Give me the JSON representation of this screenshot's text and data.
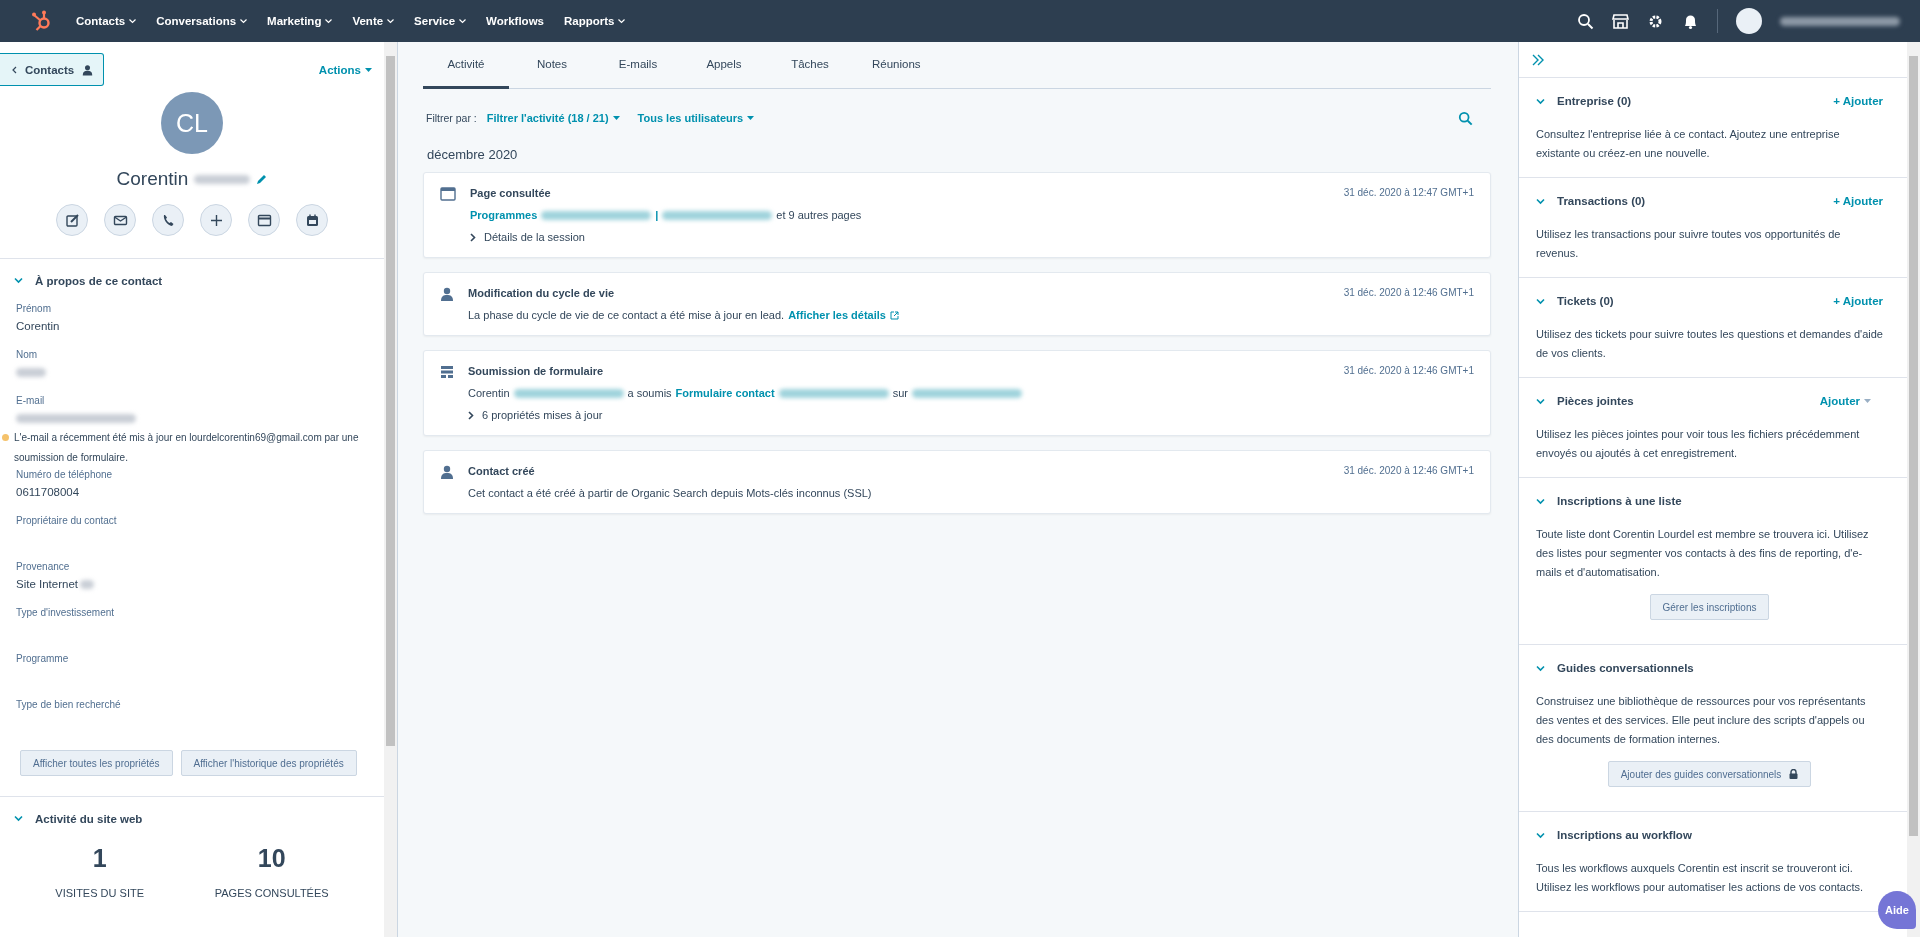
{
  "nav": {
    "items": [
      {
        "label": "Contacts",
        "dropdown": true
      },
      {
        "label": "Conversations",
        "dropdown": true
      },
      {
        "label": "Marketing",
        "dropdown": true
      },
      {
        "label": "Vente",
        "dropdown": true
      },
      {
        "label": "Service",
        "dropdown": true
      },
      {
        "label": "Workflows",
        "dropdown": false
      },
      {
        "label": "Rapports",
        "dropdown": true
      }
    ]
  },
  "contact": {
    "back": "Contacts",
    "actions": "Actions",
    "initials": "CL",
    "first_name": "Corentin"
  },
  "about": {
    "title": "À propos de ce contact",
    "expanded": true,
    "fields": [
      {
        "label": "Prénom",
        "value": "Corentin"
      },
      {
        "label": "Nom",
        "redacted": true
      },
      {
        "label": "E-mail",
        "redacted": true,
        "warning": "L'e-mail a récemment été mis à jour en lourdelcorentin69@gmail.com par une soumission de formulaire."
      },
      {
        "label": "Numéro de téléphone",
        "value": "0611708004"
      },
      {
        "label": "Propriétaire du contact"
      },
      {
        "label": "Provenance",
        "value": "Site Internet",
        "redacted": true
      },
      {
        "label": "Type d'investissement"
      },
      {
        "label": "Programme"
      },
      {
        "label": "Type de bien recherché"
      }
    ],
    "buttons": [
      "Afficher toutes les propriétés",
      "Afficher l'historique des propriétés"
    ]
  },
  "website_activity": {
    "title": "Activité du site web",
    "expanded": true,
    "stats": [
      {
        "value": "1",
        "label": "VISITES DU SITE"
      },
      {
        "value": "10",
        "label": "PAGES CONSULTÉES"
      }
    ]
  },
  "tabs": [
    {
      "label": "Activité",
      "selected": true
    },
    {
      "label": "Notes",
      "selected": false
    },
    {
      "label": "E-mails",
      "selected": false
    },
    {
      "label": "Appels",
      "selected": false
    },
    {
      "label": "Tâches",
      "selected": false
    },
    {
      "label": "Réunions",
      "selected": false
    }
  ],
  "filter": {
    "label": "Filtrer par :",
    "options": [
      "Filtrer l'activité (18 / 21)",
      "Tous les utilisateurs"
    ]
  },
  "month": "décembre 2020",
  "events": [
    {
      "kind": "page",
      "title": "Page consultée",
      "time": "31 déc. 2020 à 12:47 GMT+1",
      "parts": [
        {
          "kind": "link",
          "text": "Programmes"
        },
        {
          "kind": "redacted"
        },
        {
          "kind": "link",
          "text": "|"
        },
        {
          "kind": "redacted"
        },
        {
          "kind": "text",
          "text": "et 9 autres pages"
        }
      ],
      "detail": "Détails de la session"
    },
    {
      "kind": "lifecycle",
      "title": "Modification du cycle de vie",
      "time": "31 déc. 2020 à 12:46 GMT+1",
      "parts": [
        {
          "kind": "text",
          "text": "La phase du cycle de vie de ce contact a été mise à jour en lead."
        },
        {
          "kind": "external",
          "text": "Afficher les détails"
        }
      ]
    },
    {
      "kind": "form",
      "title": "Soumission de formulaire",
      "time": "31 déc. 2020 à 12:46 GMT+1",
      "parts": [
        {
          "kind": "text",
          "text": "Corentin"
        },
        {
          "kind": "redacted"
        },
        {
          "kind": "text",
          "text": "a soumis"
        },
        {
          "kind": "link",
          "text": "Formulaire contact"
        },
        {
          "kind": "redacted"
        },
        {
          "kind": "text",
          "text": "sur"
        },
        {
          "kind": "redacted"
        }
      ],
      "detail": "6 propriétés mises à jour"
    },
    {
      "kind": "created",
      "title": "Contact créé",
      "time": "31 déc. 2020 à 12:46 GMT+1",
      "parts": [
        {
          "kind": "text",
          "text": "Cet contact a été créé à partir de Organic Search depuis Mots-clés inconnus (SSL)"
        }
      ]
    }
  ],
  "sections": [
    {
      "title": "Entreprise (0)",
      "expanded": true,
      "action": {
        "kind": "add",
        "label": "+ Ajouter"
      },
      "text": "Consultez l'entreprise liée à ce contact. Ajoutez une entreprise existante ou créez-en une nouvelle."
    },
    {
      "title": "Transactions (0)",
      "expanded": true,
      "action": {
        "kind": "add",
        "label": "+ Ajouter"
      },
      "text": "Utilisez les transactions pour suivre toutes vos opportunités de revenus."
    },
    {
      "title": "Tickets (0)",
      "expanded": true,
      "action": {
        "kind": "add",
        "label": "+ Ajouter"
      },
      "text": "Utilisez des tickets pour suivre toutes les questions et demandes d'aide de vos clients."
    },
    {
      "title": "Pièces jointes",
      "expanded": true,
      "action": {
        "kind": "dropdown",
        "label": "Ajouter"
      },
      "text": "Utilisez les pièces jointes pour voir tous les fichiers précédemment envoyés ou ajoutés à cet enregistrement."
    },
    {
      "title": "Inscriptions à une liste",
      "expanded": true,
      "text": "Toute liste dont Corentin Lourdel est membre se trouvera ici. Utilisez des listes pour segmenter vos contacts à des fins de reporting, d'e-mails et d'automatisation.",
      "button": {
        "label": "Gérer les inscriptions",
        "locked": false
      }
    },
    {
      "title": "Guides conversationnels",
      "expanded": true,
      "text": "Construisez une bibliothèque de ressources pour vos représentants des ventes et des services. Elle peut inclure des scripts d'appels ou des documents de formation internes.",
      "button": {
        "label": "Ajouter des guides conversationnels",
        "locked": true
      }
    },
    {
      "title": "Inscriptions au workflow",
      "expanded": true,
      "text": "Tous les workflows auxquels Corentin est inscrit se trouveront ici. Utilisez les workflows pour automatiser les actions de vos contacts."
    }
  ],
  "help": "Aide"
}
